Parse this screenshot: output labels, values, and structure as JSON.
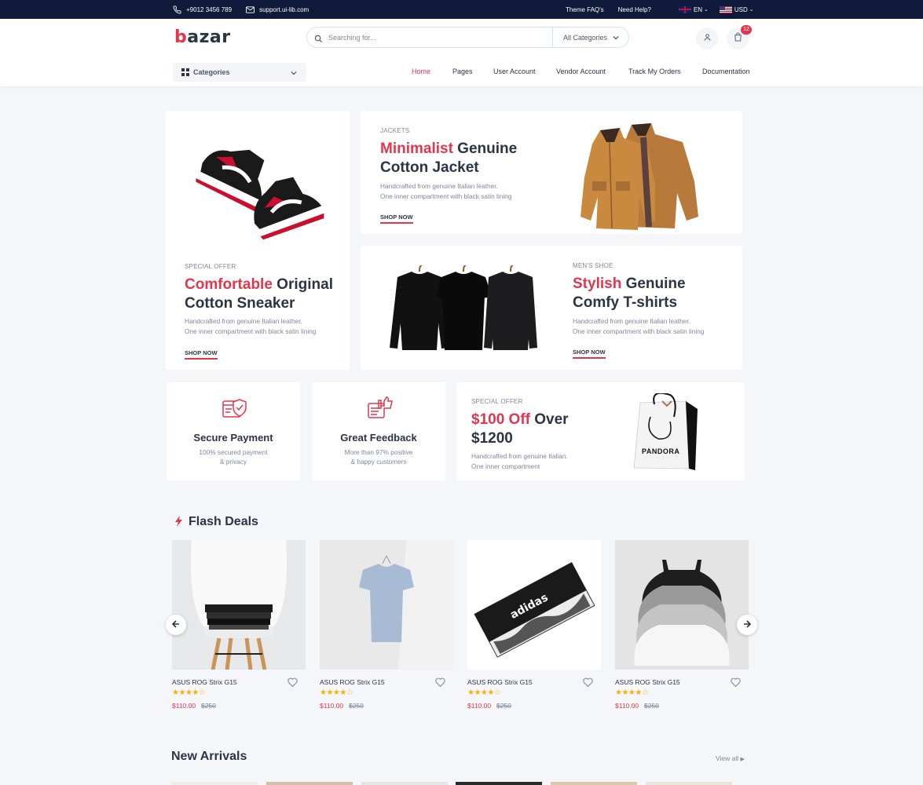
{
  "topbar": {
    "phone": "+9012 3456 789",
    "email": "support.ui-lib.com",
    "theme_faq": "Theme FAQ's",
    "need_help": "Need Help?",
    "language": "EN",
    "currency": "USD"
  },
  "header": {
    "logo_b": "b",
    "logo_rest": "azar",
    "search_placeholder": "Searching for...",
    "search_category": "All Categories",
    "cart_count": "12",
    "categories_label": "Categories"
  },
  "nav": [
    "Home",
    "Pages",
    "User Account",
    "Vendor Account",
    "Track My Orders",
    "Documentation"
  ],
  "hero": {
    "sneaker": {
      "tag": "SPECIAL OFFER",
      "highlight": "Comfortable",
      "title_rest": " Original",
      "title_line2": "Cotton Sneaker",
      "desc1": "Handcrafted from genuine Italian leather.",
      "desc2": "One inner compartment with black satin lining",
      "cta": "SHOP NOW"
    },
    "jacket": {
      "tag": "JACKETS",
      "highlight": "Minimalist",
      "title_rest": " Genuine",
      "title_line2": "Cotton Jacket",
      "desc1": "Handcrafted from genuine Italian leather.",
      "desc2": "One inner compartment with black satin lining",
      "cta": "SHOP NOW"
    },
    "tshirt": {
      "tag": "MEN'S SHOE",
      "highlight": "Stylish",
      "title_rest": " Genuine",
      "title_line2": "Comfy T-shirts",
      "desc1": "Handcrafted from genuine Italian leather.",
      "desc2": "One inner compartment with black satin lining",
      "cta": "SHOP NOW"
    }
  },
  "features": [
    {
      "title": "Secure Payment",
      "line1": "100% secured payment",
      "line2": "& privacy"
    },
    {
      "title": "Great Feedback",
      "line1": "More than 97% positive",
      "line2": "& happy customers"
    }
  ],
  "offer": {
    "tag": "SPECIAL OFFER",
    "highlight": "$100 Off",
    "title_rest": " Over",
    "title_line2": "$1200",
    "desc1": "Handcrafted from genuine Italian.",
    "desc2": "One inner compartment",
    "bag_brand": "PANDORA"
  },
  "flash_deals": {
    "title": "Flash Deals",
    "products": [
      {
        "name": "ASUS ROG Strix G15",
        "price": "$110.00",
        "old_price": "$250",
        "rating": 4
      },
      {
        "name": "ASUS ROG Strix G15",
        "price": "$110.00",
        "old_price": "$250",
        "rating": 4
      },
      {
        "name": "ASUS ROG Strix G15",
        "price": "$110.00",
        "old_price": "$250",
        "rating": 4
      },
      {
        "name": "ASUS ROG Strix G15",
        "price": "$110.00",
        "old_price": "$250",
        "rating": 4
      }
    ]
  },
  "new_arrivals": {
    "title": "New Arrivals",
    "view_all": "View all"
  },
  "colors": {
    "accent": "#e3364e",
    "topbar": "#0f1a3a",
    "star": "#faaf00"
  }
}
